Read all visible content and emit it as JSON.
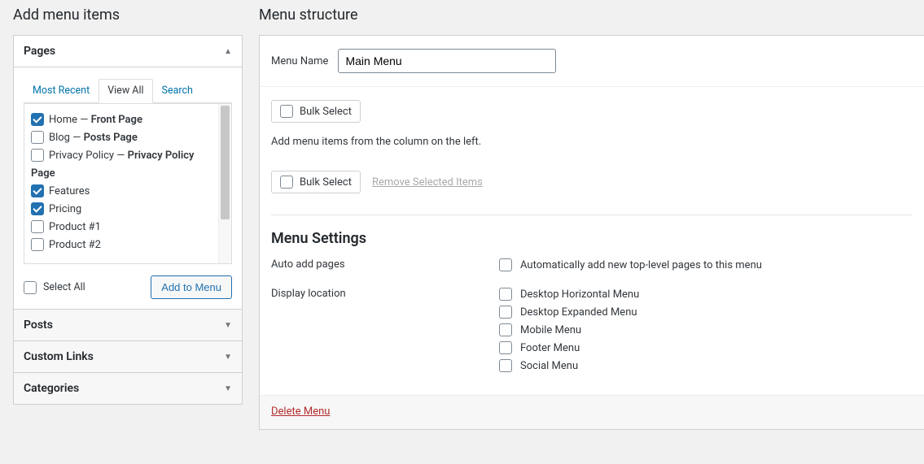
{
  "left": {
    "title": "Add menu items",
    "accordions": {
      "pages": "Pages",
      "posts": "Posts",
      "custom_links": "Custom Links",
      "categories": "Categories"
    },
    "tabs": {
      "most_recent": "Most Recent",
      "view_all": "View All",
      "search": "Search"
    },
    "items": [
      {
        "label": "Home",
        "suffix": "Front Page",
        "checked": true
      },
      {
        "label": "Blog",
        "suffix": "Posts Page",
        "checked": false
      },
      {
        "label": "Privacy Policy",
        "suffix": "Privacy Policy",
        "checked": false
      }
    ],
    "sublabel": "Page",
    "subitems": [
      {
        "label": "Features",
        "checked": true
      },
      {
        "label": "Pricing",
        "checked": true
      },
      {
        "label": "Product #1",
        "checked": false
      },
      {
        "label": "Product #2",
        "checked": false
      }
    ],
    "select_all": "Select All",
    "add_button": "Add to Menu"
  },
  "right": {
    "title": "Menu structure",
    "menu_name_label": "Menu Name",
    "menu_name_value": "Main Menu",
    "bulk_select": "Bulk Select",
    "instruction": "Add menu items from the column on the left.",
    "remove_selected": "Remove Selected Items",
    "settings_title": "Menu Settings",
    "auto_add_label": "Auto add pages",
    "auto_add_opt": "Automatically add new top-level pages to this menu",
    "display_loc_label": "Display location",
    "locations": [
      "Desktop Horizontal Menu",
      "Desktop Expanded Menu",
      "Mobile Menu",
      "Footer Menu",
      "Social Menu"
    ],
    "delete": "Delete Menu"
  }
}
